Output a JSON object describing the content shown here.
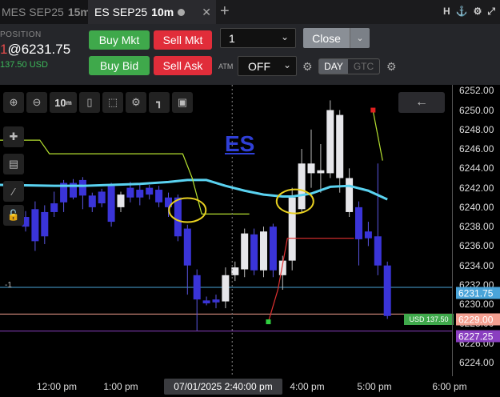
{
  "tabs": [
    {
      "label": "MES SEP25",
      "timeframe": "15m"
    },
    {
      "label": "ES SEP25",
      "timeframe": "10m",
      "close": "✕"
    }
  ],
  "tab_add": "+",
  "window_icons": [
    "H",
    "⚓",
    "⚙",
    "⤢"
  ],
  "position": {
    "label": "POSITION",
    "qty": "1",
    "price": "@6231.75",
    "pnl": "137.50 USD"
  },
  "order": {
    "buy_mkt": "Buy Mkt",
    "sell_mkt": "Sell Mkt",
    "buy_bid": "Buy Bid",
    "sell_ask": "Sell Ask",
    "quantity": "1",
    "close": "Close",
    "atm_label": "ATM",
    "atm_value": "OFF",
    "tif_day": "DAY",
    "tif_gtc": "GTC"
  },
  "chart_toolbar": {
    "timeframe": "10",
    "timeframe_unit": "m",
    "back": "←"
  },
  "symbol": "ES",
  "line_label": "-1",
  "colors": {
    "bull": "#e6e6ea",
    "bear": "#3a34d8",
    "ma": "#5ad2f0",
    "lime": "#b5e030",
    "red_line": "#e03030",
    "current_price": "#4aa4d9",
    "entry": "#f4a091",
    "purple": "#8a3fc0"
  },
  "tags": {
    "current": "6231.75",
    "entry": "6229.00",
    "purple": "6227.25",
    "usd": "USD 137.50"
  },
  "chart_data": {
    "type": "candlestick",
    "y_ticks": [
      "6252.00",
      "6250.00",
      "6248.00",
      "6246.00",
      "6244.00",
      "6242.00",
      "6240.00",
      "6238.00",
      "6236.00",
      "6234.00",
      "6232.00",
      "6230.00",
      "6228.00",
      "6226.00",
      "6224.00"
    ],
    "ylim": [
      6222.6,
      6252.6
    ],
    "x_labels": [
      "12:00 pm",
      "1:00 pm",
      "07/01/2025 2:40:00 pm",
      "4:00 pm",
      "5:00 pm",
      "6:00 pm"
    ],
    "candles": [
      {
        "o": 6239.0,
        "h": 6239.6,
        "l": 6237.5,
        "c": 6238.0
      },
      {
        "o": 6239.8,
        "h": 6240.6,
        "l": 6235.5,
        "c": 6236.5
      },
      {
        "o": 6239.5,
        "h": 6240.2,
        "l": 6236.2,
        "c": 6237.0
      },
      {
        "o": 6240.4,
        "h": 6241.6,
        "l": 6239.0,
        "c": 6239.5
      },
      {
        "o": 6242.5,
        "h": 6242.8,
        "l": 6239.5,
        "c": 6240.5
      },
      {
        "o": 6242.5,
        "h": 6242.9,
        "l": 6240.8,
        "c": 6241.0
      },
      {
        "o": 6242.8,
        "h": 6243.1,
        "l": 6239.8,
        "c": 6241.2
      },
      {
        "o": 6241.2,
        "h": 6241.5,
        "l": 6239.5,
        "c": 6240.0
      },
      {
        "o": 6241.6,
        "h": 6241.9,
        "l": 6240.0,
        "c": 6240.4
      },
      {
        "o": 6242.2,
        "h": 6242.5,
        "l": 6238.0,
        "c": 6238.5
      },
      {
        "o": 6240.0,
        "h": 6241.6,
        "l": 6239.5,
        "c": 6241.3
      },
      {
        "o": 6242.0,
        "h": 6242.6,
        "l": 6240.5,
        "c": 6241.0
      },
      {
        "o": 6241.8,
        "h": 6242.4,
        "l": 6240.2,
        "c": 6241.0
      },
      {
        "o": 6242.0,
        "h": 6242.3,
        "l": 6240.8,
        "c": 6241.3
      },
      {
        "o": 6241.8,
        "h": 6242.2,
        "l": 6240.0,
        "c": 6240.5
      },
      {
        "o": 6241.0,
        "h": 6241.5,
        "l": 6239.0,
        "c": 6240.0
      },
      {
        "o": 6241.0,
        "h": 6241.3,
        "l": 6236.5,
        "c": 6237.0
      },
      {
        "o": 6237.8,
        "h": 6238.2,
        "l": 6231.0,
        "c": 6234.0
      },
      {
        "o": 6233.0,
        "h": 6233.6,
        "l": 6227.3,
        "c": 6230.5
      },
      {
        "o": 6230.4,
        "h": 6230.8,
        "l": 6229.9,
        "c": 6230.1
      },
      {
        "o": 6230.5,
        "h": 6231.0,
        "l": 6229.6,
        "c": 6230.2
      },
      {
        "o": 6230.3,
        "h": 6233.8,
        "l": 6229.6,
        "c": 6233.0
      },
      {
        "o": 6233.0,
        "h": 6234.4,
        "l": 6232.4,
        "c": 6233.8
      },
      {
        "o": 6233.6,
        "h": 6237.8,
        "l": 6232.8,
        "c": 6237.3
      },
      {
        "o": 6237.2,
        "h": 6237.8,
        "l": 6233.0,
        "c": 6233.5
      },
      {
        "o": 6233.5,
        "h": 6238.0,
        "l": 6232.8,
        "c": 6237.5
      },
      {
        "o": 6238.0,
        "h": 6238.3,
        "l": 6232.8,
        "c": 6233.5
      },
      {
        "o": 6233.0,
        "h": 6235.0,
        "l": 6231.5,
        "c": 6234.5
      },
      {
        "o": 6234.5,
        "h": 6242.0,
        "l": 6233.5,
        "c": 6241.0
      },
      {
        "o": 6239.8,
        "h": 6246.0,
        "l": 6239.5,
        "c": 6244.5
      },
      {
        "o": 6243.5,
        "h": 6248.0,
        "l": 6242.0,
        "c": 6244.5
      },
      {
        "o": 6243.5,
        "h": 6246.5,
        "l": 6241.5,
        "c": 6243.8
      },
      {
        "o": 6243.5,
        "h": 6251.0,
        "l": 6243.0,
        "c": 6250.0
      },
      {
        "o": 6243.0,
        "h": 6250.0,
        "l": 6241.5,
        "c": 6249.5
      },
      {
        "o": 6239.5,
        "h": 6244.0,
        "l": 6239.0,
        "c": 6243.0
      },
      {
        "o": 6240.0,
        "h": 6240.6,
        "l": 6234.0,
        "c": 6236.7
      },
      {
        "o": 6237.5,
        "h": 6238.5,
        "l": 6236.0,
        "c": 6236.8
      },
      {
        "o": 6237.0,
        "h": 6244.5,
        "l": 6233.0,
        "c": 6234.0
      },
      {
        "o": 6234.0,
        "h": 6234.4,
        "l": 6228.5,
        "c": 6228.8
      }
    ],
    "overlays": [
      {
        "name": "moving-average",
        "points": [
          [
            0,
            6242.3
          ],
          [
            3,
            6242.2
          ],
          [
            6,
            6242.2
          ],
          [
            9,
            6242.3
          ],
          [
            12,
            6242.4
          ],
          [
            15,
            6242.6
          ],
          [
            17,
            6242.8
          ],
          [
            19,
            6242.8
          ],
          [
            21,
            6242.2
          ],
          [
            23,
            6241.7
          ],
          [
            25,
            6241.3
          ],
          [
            27,
            6241.1
          ],
          [
            28,
            6241.1
          ],
          [
            30,
            6241.4
          ],
          [
            32,
            6242.1
          ],
          [
            34,
            6242.2
          ],
          [
            36,
            6241.7
          ],
          [
            38,
            6240.8
          ]
        ]
      },
      {
        "name": "lime-trail",
        "points": [
          [
            0,
            6246.9
          ],
          [
            1.5,
            6246.9
          ],
          [
            2.5,
            6245.5
          ],
          [
            16.5,
            6245.5
          ],
          [
            17.5,
            6243.0
          ],
          [
            18.5,
            6239.3
          ],
          [
            23.5,
            6239.3
          ]
        ]
      },
      {
        "name": "red-trail",
        "points": [
          [
            25.5,
            6228.2
          ],
          [
            26.5,
            6231.5
          ],
          [
            27.5,
            6236.8
          ],
          [
            34.5,
            6236.8
          ]
        ]
      },
      {
        "name": "lime-tail",
        "points": [
          [
            36.5,
            6249.9
          ],
          [
            37.5,
            6244.8
          ]
        ]
      }
    ],
    "markers": [
      {
        "name": "green-marker",
        "x": 25.5,
        "y": 6228.2
      },
      {
        "name": "red-marker",
        "x": 36.5,
        "y": 6250.0
      }
    ],
    "levels": [
      {
        "name": "current-price-line",
        "y": 6231.75
      },
      {
        "name": "entry-line",
        "y": 6229.0
      },
      {
        "name": "purple-line",
        "y": 6227.25
      }
    ],
    "ellipses": [
      {
        "name": "highlight-ellipse-1",
        "x": 17,
        "y": 6239.7
      },
      {
        "name": "highlight-ellipse-2",
        "x": 28.3,
        "y": 6240.6
      }
    ],
    "crosshair_x": 21.7
  }
}
